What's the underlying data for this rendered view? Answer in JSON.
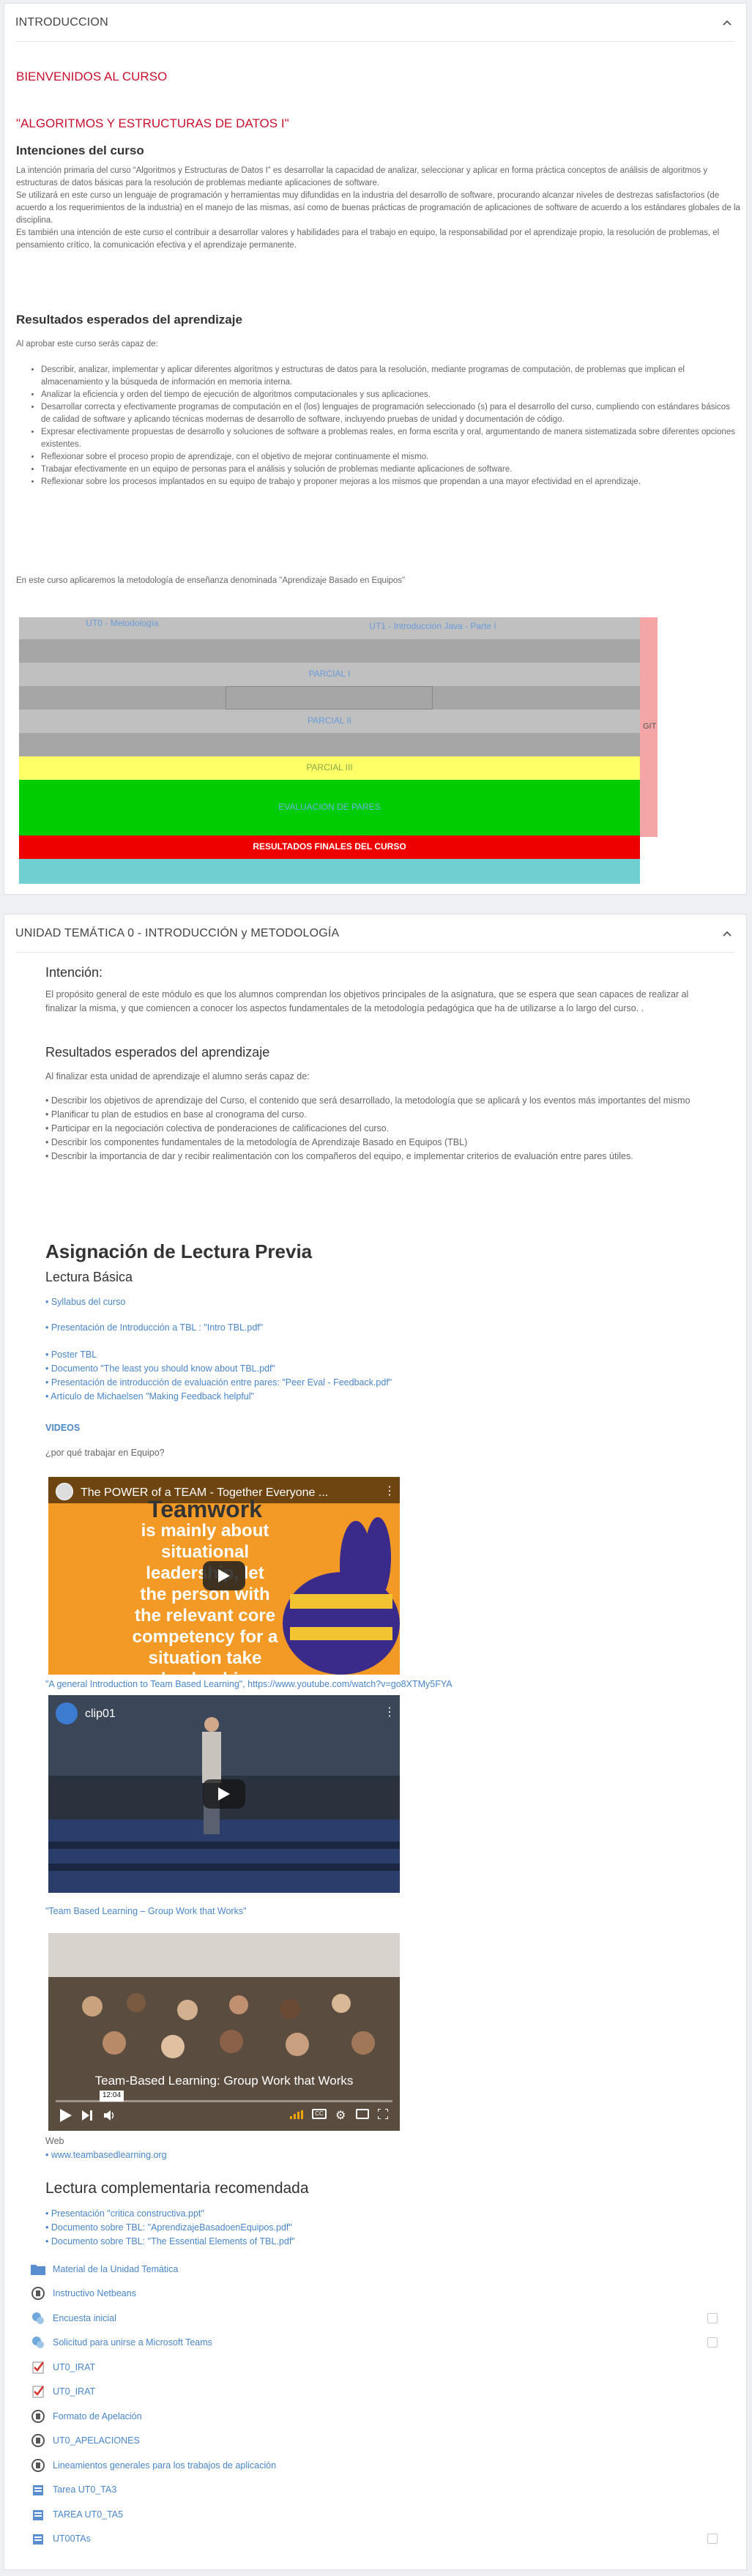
{
  "section_intro": {
    "header": "INTRODUCCION",
    "welcome": "BIENVENIDOS AL CURSO",
    "course_name": "\"ALGORITMOS Y ESTRUCTURAS DE DATOS I\"",
    "intentions_title": "Intenciones del curso",
    "intentions_paragraphs": [
      "La intención primaria del curso “Algoritmos y Estructuras de Datos I” es desarrollar la capacidad de analizar, seleccionar y aplicar en forma práctica conceptos de análisis de algoritmos y estructuras de datos básicas para la resolución de problemas mediante aplicaciones de software.",
      "Se utilizará en este curso un lenguaje de programación y herramientas muy difundidas en la industria del desarrollo de software, procurando alcanzar niveles de destrezas satisfactorios (de acuerdo a los requerimientos de la industria) en el manejo de las mismas, así como de buenas prácticas de programación de aplicaciones de software de acuerdo a los estándares globales de la disciplina.",
      "Es también una intención de este curso el contribuir a desarrollar valores y habilidades para el trabajo en equipo, la responsabilidad por el aprendizaje propio, la resolución de problemas, el pensamiento crítico, la comunicación efectiva y el aprendizaje permanente."
    ],
    "outcomes_title": "Resultados esperados del aprendizaje",
    "outcomes_intro": "Al aprobar este curso serás capaz de:",
    "outcomes": [
      "Describir, analizar, implementar y aplicar diferentes algoritmos y estructuras de datos para la resolución, mediante programas de computación, de problemas que implican el almacenamiento y la búsqueda de información en memoria interna.",
      "Analizar la eficiencia y orden del tiempo de ejecución de algoritmos computacionales y sus aplicaciones.",
      "Desarrollar correcta y efectivamente programas de computación en el (los) lenguajes de programación seleccionado (s) para el desarrollo del curso, cumpliendo con estándares básicos de calidad de software y aplicando técnicas modernas de desarrollo de software, incluyendo pruebas de unidad y documentación de código.",
      "Expresar efectivamente propuestas de desarrollo y soluciones de software a problemas reales, en forma escrita y oral, argumentando de manera sistematizada sobre diferentes opciones existentes.",
      "Reflexionar sobre el proceso propio de aprendizaje, con el objetivo de mejorar continuamente el mismo.",
      "Trabajar efectivamente en un equipo de personas para el análisis y solución de problemas mediante aplicaciones de software.",
      "Reflexionar sobre los procesos implantados en su equipo de trabajo y proponer mejoras a los mismos que propendan a una mayor efectividad en el aprendizaje."
    ],
    "methodology": "En este curso aplicaremos la metodología de enseñanza denominada \"Aprendizaje Basado en Equipos\"",
    "schedule": {
      "row1_a": "UT0 - Metodología",
      "row1_b": "UT1 - Introducción Java - Parte I",
      "parcial1": "PARCIAL I",
      "parcial2": "PARCIAL II",
      "parcial3": "PARCIAL III",
      "peer_eval": "EVALUACION DE PARES",
      "final_results": "RESULTADOS FINALES DEL CURSO",
      "git": "GIT"
    }
  },
  "section_ut0": {
    "header": "UNIDAD TEMÁTICA 0 - INTRODUCCIÓN y METODOLOGÍA",
    "intention_title": "Intención:",
    "intention_text": "El propósito general de este módulo es que los alumnos comprendan los objetivos principales de la asignatura, que se espera que sean capaces de realizar al finalizar la misma, y que comiencen a conocer los aspectos fundamentales de la metodología pedagógica que ha de utilizarse a lo largo del curso. .",
    "outcomes_title": "Resultados esperados del aprendizaje",
    "outcomes_intro": "Al finalizar esta unidad de aprendizaje el alumno serás capaz de:",
    "outcomes": [
      "• Describir los objetivos de aprendizaje del Curso, el contenido que será desarrollado, la metodología que se aplicará y los eventos más importantes del mismo",
      "• Planificar tu plan de estudios en base al cronograma del curso.",
      "• Participar en la negociación colectiva de ponderaciones de calificaciones del curso.",
      "• Describir los componentes fundamentales de la metodología de Aprendizaje Basado en Equipos (TBL)",
      "• Describir la importancia de dar y recibir realimentación con los compañeros del equipo, e implementar criterios de evaluación entre pares útiles."
    ],
    "reading_title": "Asignación de Lectura Previa",
    "basic_reading_title": "Lectura Básica",
    "basic_links": [
      "• Syllabus del curso",
      "• Presentación de Introducción a TBL : \"Intro TBL.pdf\"",
      "• Poster TBL",
      "• Documento \"The least you should know about TBL.pdf\"",
      "• Presentación de introducción de evaluación entre pares: \"Peer Eval - Feedback.pdf\"",
      "• Artículo de Michaelsen \"Making Feedback helpful\""
    ],
    "videos_label": "VIDEOS",
    "videos_question": "¿por qué trabajar en Equipo?",
    "video1": {
      "title": "The POWER of a TEAM - Together Everyone ...",
      "overlay_lines": [
        "Teamwork",
        "is mainly about",
        "situational",
        "leadership, let",
        "the person with",
        "the relevant core",
        "competency for a",
        "situation take",
        "leadership"
      ]
    },
    "video1_caption": "\"A general Introduction to Team Based Learning\", https://www.youtube.com/watch?v=go8XTMy5FYA",
    "video2": {
      "title": "clip01"
    },
    "video2_caption": "\"Team Based Learning – Group Work that Works\"",
    "video3": {
      "title": "Team-Based Learning: Group Work that Works",
      "time": "12:04"
    },
    "web_label": "Web",
    "web_link": "• www.teambasedlearning.org",
    "extra_reading_title": "Lectura complementaria recomendada",
    "extra_links": [
      "• Presentación \"critica constructiva.ppt\"",
      "• Documento sobre TBL: \"AprendizajeBasadoenEquipos.pdf\"",
      "• Documento sobre TBL: \"The Essential Elements of TBL.pdf\""
    ],
    "activities": [
      {
        "name": "Material de la Unidad Temática",
        "icon": "folder-icon",
        "checkbox": false
      },
      {
        "name": "Instructivo Netbeans",
        "icon": "page-icon",
        "checkbox": false
      },
      {
        "name": "Encuesta inicial",
        "icon": "survey-icon",
        "checkbox": true
      },
      {
        "name": "Solicitud para unirse a Microsoft Teams",
        "icon": "survey-icon",
        "checkbox": true
      },
      {
        "name": "UT0_IRAT",
        "icon": "quiz-icon",
        "checkbox": false
      },
      {
        "name": "UT0_IRAT",
        "icon": "quiz-icon",
        "checkbox": false
      },
      {
        "name": "Formato de Apelación",
        "icon": "page-icon",
        "checkbox": false
      },
      {
        "name": "UT0_APELACIONES",
        "icon": "page-icon",
        "checkbox": false
      },
      {
        "name": "Lineamientos generales para los trabajos de aplicación",
        "icon": "page-icon",
        "checkbox": false
      },
      {
        "name": "Tarea UT0_TA3",
        "icon": "assign-icon",
        "checkbox": false
      },
      {
        "name": "TAREA UT0_TA5",
        "icon": "assign-icon",
        "checkbox": false
      },
      {
        "name": "UT00TAs",
        "icon": "assign-icon",
        "checkbox": true
      }
    ]
  },
  "colors": {
    "title_red": "#c8102e",
    "link_blue": "#4a86c7",
    "sched_gray": "#a6a6a6",
    "sched_lightgray": "#c0c0c0",
    "sched_yellow": "#ffff66",
    "sched_green": "#00cc00",
    "sched_red": "#ee0000",
    "sched_teal": "#6fcfd1",
    "sched_pink": "#f4a5a5"
  }
}
